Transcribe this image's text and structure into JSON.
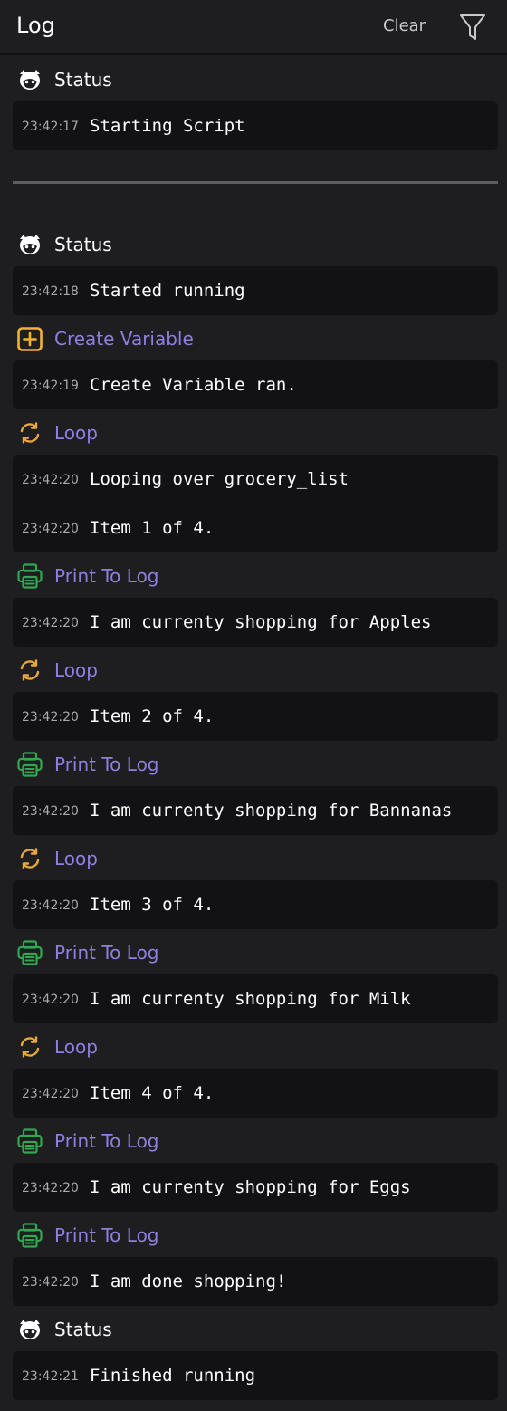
{
  "header": {
    "title": "Log",
    "clear_label": "Clear",
    "filter_icon": "filter-icon"
  },
  "colors": {
    "background": "#1e1e21",
    "panel": "#121215",
    "action_label": "#8f7fe0",
    "create_variable_icon": "#f2b233",
    "loop_icon": "#e8a838",
    "print_icon": "#2fa84f",
    "status_icon": "#ffffff"
  },
  "first_run": {
    "groups": [
      {
        "label": "Status",
        "kind": "status",
        "icon": "status-mascot-icon",
        "entries": [
          {
            "time": "23:42:17",
            "message": "Starting Script"
          }
        ]
      }
    ]
  },
  "groups": [
    {
      "label": "Status",
      "kind": "status",
      "icon": "status-mascot-icon",
      "entries": [
        {
          "time": "23:42:18",
          "message": "Started running"
        }
      ]
    },
    {
      "label": "Create Variable",
      "kind": "create-variable",
      "icon": "plus-square-icon",
      "entries": [
        {
          "time": "23:42:19",
          "message": "Create Variable ran."
        }
      ]
    },
    {
      "label": "Loop",
      "kind": "loop",
      "icon": "loop-icon",
      "entries": [
        {
          "time": "23:42:20",
          "message": "Looping over grocery_list"
        },
        {
          "time": "23:42:20",
          "message": "Item 1 of 4."
        }
      ]
    },
    {
      "label": "Print To Log",
      "kind": "print",
      "icon": "printer-icon",
      "entries": [
        {
          "time": "23:42:20",
          "message": "I am currenty shopping for Apples"
        }
      ]
    },
    {
      "label": "Loop",
      "kind": "loop",
      "icon": "loop-icon",
      "entries": [
        {
          "time": "23:42:20",
          "message": "Item 2 of 4."
        }
      ]
    },
    {
      "label": "Print To Log",
      "kind": "print",
      "icon": "printer-icon",
      "entries": [
        {
          "time": "23:42:20",
          "message": "I am currenty shopping for Bannanas"
        }
      ]
    },
    {
      "label": "Loop",
      "kind": "loop",
      "icon": "loop-icon",
      "entries": [
        {
          "time": "23:42:20",
          "message": "Item 3 of 4."
        }
      ]
    },
    {
      "label": "Print To Log",
      "kind": "print",
      "icon": "printer-icon",
      "entries": [
        {
          "time": "23:42:20",
          "message": "I am currenty shopping for Milk"
        }
      ]
    },
    {
      "label": "Loop",
      "kind": "loop",
      "icon": "loop-icon",
      "entries": [
        {
          "time": "23:42:20",
          "message": "Item 4 of 4."
        }
      ]
    },
    {
      "label": "Print To Log",
      "kind": "print",
      "icon": "printer-icon",
      "entries": [
        {
          "time": "23:42:20",
          "message": "I am currenty shopping for Eggs"
        }
      ]
    },
    {
      "label": "Print To Log",
      "kind": "print",
      "icon": "printer-icon",
      "entries": [
        {
          "time": "23:42:20",
          "message": "I am done shopping!"
        }
      ]
    },
    {
      "label": "Status",
      "kind": "status",
      "icon": "status-mascot-icon",
      "entries": [
        {
          "time": "23:42:21",
          "message": "Finished running"
        }
      ]
    }
  ]
}
